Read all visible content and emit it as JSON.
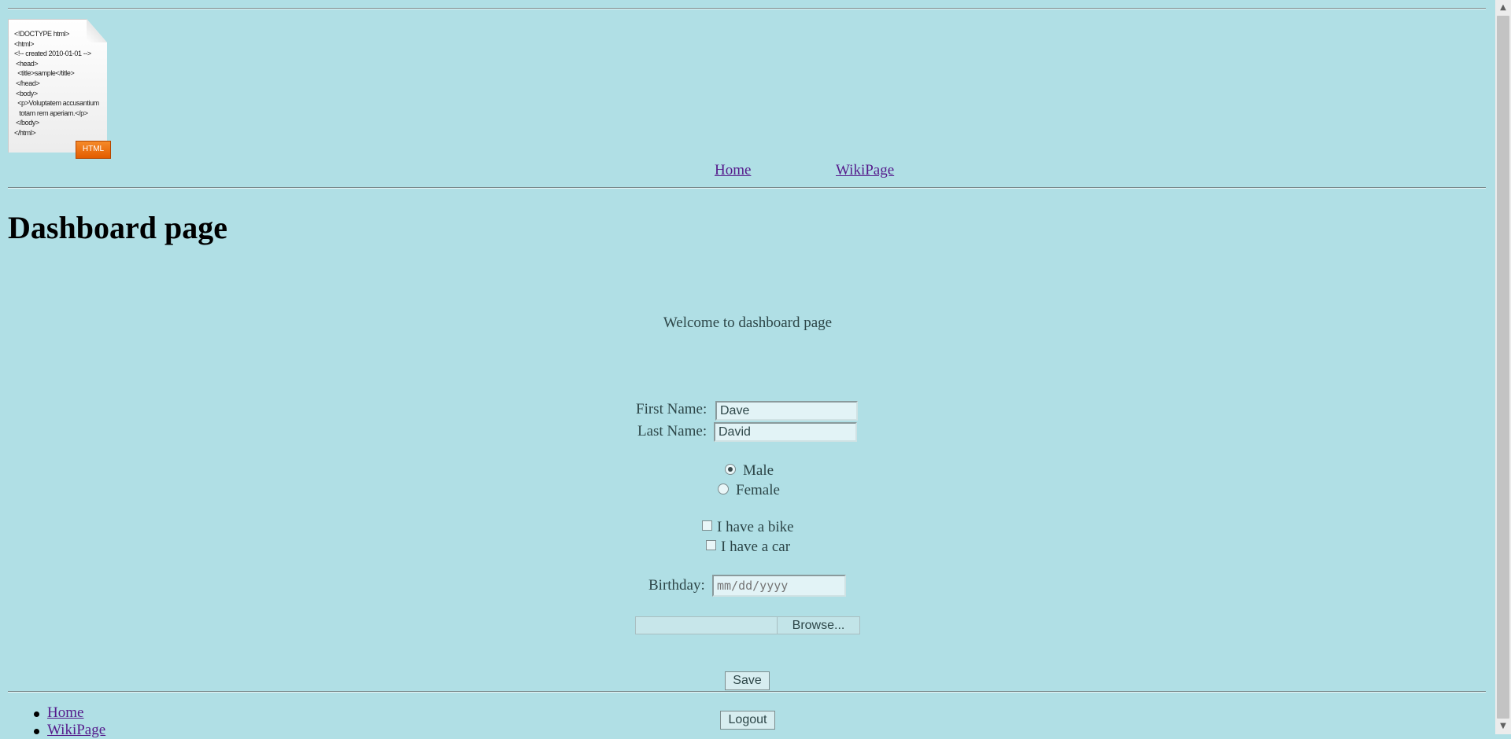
{
  "logo": {
    "code_lines": [
      "<!DOCTYPE html>",
      "<html>",
      "<!-- created 2010-01-01 -->",
      " <head>",
      "  <title>sample</title>",
      " </head>",
      " <body>",
      "  <p>Voluptatem accusantium",
      "   totam rem aperiam.</p>",
      " </body>",
      "</html>"
    ],
    "badge": "HTML"
  },
  "nav": {
    "home": "Home",
    "wiki": "WikiPage"
  },
  "page_title": "Dashboard page",
  "welcome": "Welcome to dashboard page",
  "form": {
    "first_name_label": "First Name:",
    "first_name_value": "Dave",
    "last_name_label": "Last Name:",
    "last_name_value": "David",
    "gender_male": "Male",
    "gender_female": "Female",
    "gender_selected": "Male",
    "bike_label": "I have a bike",
    "car_label": "I have a car",
    "birthday_label": "Birthday:",
    "birthday_placeholder": "mm/dd/yyyy",
    "browse_label": "Browse...",
    "save_label": "Save",
    "logout_label": "Logout"
  },
  "footer_nav": {
    "home": "Home",
    "wiki": "WikiPage"
  },
  "colors": {
    "background": "#b0dfe5",
    "link": "#551a8b",
    "logo_badge": "#e35d00"
  },
  "icons": [
    "html-file-icon",
    "radio-icon",
    "checkbox-icon",
    "scroll-up-icon",
    "scroll-down-icon"
  ]
}
